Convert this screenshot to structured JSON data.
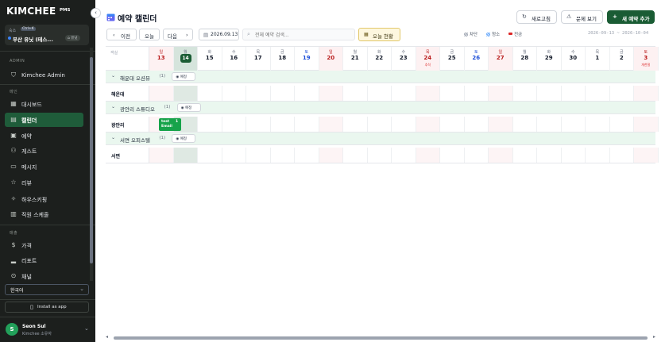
{
  "sidebar": {
    "logo": "KIMCHEE",
    "logo_sub": "PMS",
    "property_label": "숙소",
    "property_badge": "Ctrl+K",
    "property_name": "부산 유닛 (테스...",
    "property_tag": "유닛",
    "sections": {
      "admin": "ADMIN",
      "main": "메인",
      "ops": "매출"
    },
    "admin_item": "Kimchee Admin",
    "items": [
      {
        "label": "대시보드",
        "icon": "grid-icon"
      },
      {
        "label": "캘린더",
        "icon": "calendar-icon",
        "active": true
      },
      {
        "label": "예약",
        "icon": "booking-icon"
      },
      {
        "label": "게스트",
        "icon": "users-icon"
      },
      {
        "label": "메시지",
        "icon": "message-icon"
      },
      {
        "label": "리뷰",
        "icon": "star-icon"
      },
      {
        "label": "하우스키핑",
        "icon": "sparkle-icon"
      },
      {
        "label": "직원 스케줄",
        "icon": "schedule-icon"
      }
    ],
    "ops_items": [
      {
        "label": "가격",
        "icon": "dollar-icon"
      },
      {
        "label": "리포트",
        "icon": "chart-icon"
      },
      {
        "label": "채널",
        "icon": "channel-icon"
      }
    ],
    "language": "한국어",
    "install": "Install as app",
    "user": {
      "initial": "S",
      "name": "Seon Sul",
      "role": "Kimchee 소유자"
    }
  },
  "header": {
    "title": "예약 캘린더",
    "refresh": "새로고침",
    "issues": "문제 보기",
    "new_booking": "새 예약 추가"
  },
  "toolbar": {
    "prev": "이전",
    "today": "오늘",
    "next": "다음",
    "date": "2026.09.13",
    "search_placeholder": "전체 예약 검색...",
    "today_status": "오늘 현황",
    "legend": [
      {
        "label": "차단",
        "color": "#9ca3af"
      },
      {
        "label": "청소",
        "color": "#60a5fa"
      },
      {
        "label": "전금",
        "color": "#dc2626"
      }
    ],
    "range": "2026-09-13 ~ 2026-10-04"
  },
  "grid": {
    "corner_label": "객실",
    "days": [
      {
        "dow": "일",
        "num": "13",
        "type": "sun"
      },
      {
        "dow": "월",
        "num": "14",
        "type": "today"
      },
      {
        "dow": "화",
        "num": "15",
        "type": ""
      },
      {
        "dow": "수",
        "num": "16",
        "type": ""
      },
      {
        "dow": "목",
        "num": "17",
        "type": ""
      },
      {
        "dow": "금",
        "num": "18",
        "type": ""
      },
      {
        "dow": "토",
        "num": "19",
        "type": "sat"
      },
      {
        "dow": "일",
        "num": "20",
        "type": "sun"
      },
      {
        "dow": "월",
        "num": "21",
        "type": ""
      },
      {
        "dow": "화",
        "num": "22",
        "type": ""
      },
      {
        "dow": "수",
        "num": "23",
        "type": ""
      },
      {
        "dow": "목",
        "num": "24",
        "type": "holiday",
        "holiday": "추석"
      },
      {
        "dow": "금",
        "num": "25",
        "type": ""
      },
      {
        "dow": "토",
        "num": "26",
        "type": "sat"
      },
      {
        "dow": "일",
        "num": "27",
        "type": "sun"
      },
      {
        "dow": "월",
        "num": "28",
        "type": ""
      },
      {
        "dow": "화",
        "num": "29",
        "type": ""
      },
      {
        "dow": "수",
        "num": "30",
        "type": ""
      },
      {
        "dow": "목",
        "num": "1",
        "type": ""
      },
      {
        "dow": "금",
        "num": "2",
        "type": ""
      },
      {
        "dow": "토",
        "num": "3",
        "type": "holiday",
        "holiday": "개천절"
      }
    ],
    "groups": [
      {
        "name": "해운대 오션뷰",
        "count": "(1)",
        "btn": "예정",
        "room": "해운대"
      },
      {
        "name": "광안리 스튜디오",
        "count": "(1)",
        "btn": "예정",
        "room": "광안리"
      },
      {
        "name": "서면 오피스텔",
        "count": "(1)",
        "btn": "예정",
        "room": "서면"
      }
    ],
    "booking": {
      "line1": "test",
      "line2": "Email",
      "nights": "1"
    }
  }
}
